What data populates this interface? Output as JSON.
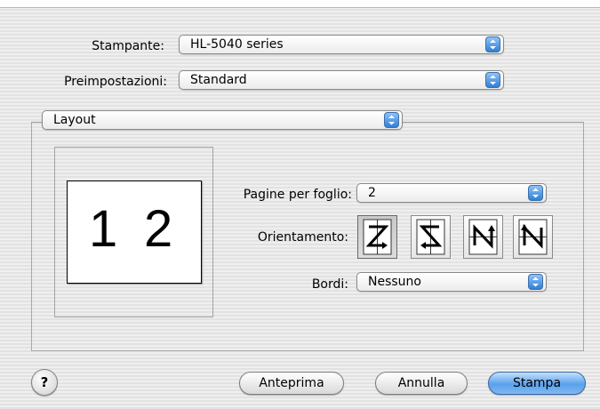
{
  "printer": {
    "label": "Stampante:",
    "value": "HL-5040 series"
  },
  "presets": {
    "label": "Preimpostazioni:",
    "value": "Standard"
  },
  "panel": {
    "value": "Layout"
  },
  "layout": {
    "preview_pages": [
      "1",
      "2"
    ],
    "pages_per_sheet": {
      "label": "Pagine per foglio:",
      "value": "2"
    },
    "orientation": {
      "label": "Orientamento:",
      "selected_index": 0,
      "options": [
        "z-orientation-icon",
        "reverse-z-orientation-icon",
        "n-orientation-icon",
        "reverse-n-orientation-icon"
      ]
    },
    "border": {
      "label": "Bordi:",
      "value": "Nessuno"
    }
  },
  "buttons": {
    "help": "?",
    "preview": "Anteprima",
    "cancel": "Annulla",
    "print": "Stampa"
  },
  "colors": {
    "accent": "#3a86e0",
    "default_button": "#5aa1ec"
  }
}
